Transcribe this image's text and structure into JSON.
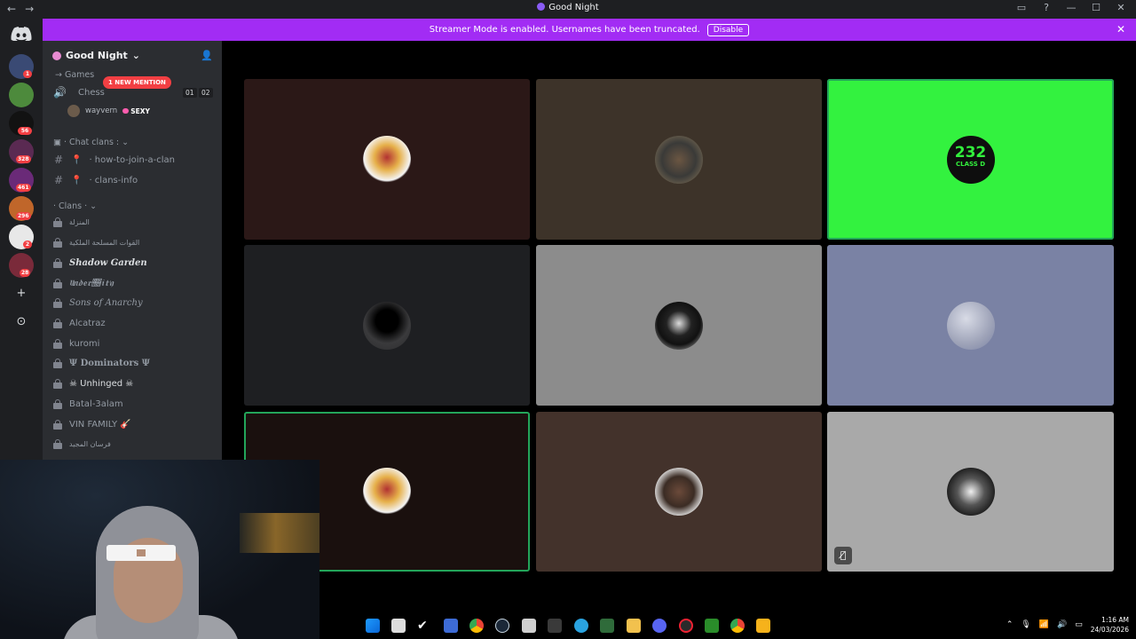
{
  "window": {
    "title": "Good Night",
    "nav_back": "←",
    "nav_forward": "→",
    "controls": [
      "▭",
      "?",
      "—",
      "☐",
      "✕"
    ]
  },
  "banner": {
    "text": "Streamer Mode is enabled. Usernames have been truncated.",
    "disable_label": "Disable",
    "close": "✕"
  },
  "guild_badges": [
    "1",
    "56",
    "328",
    "461",
    "296",
    "2",
    "28"
  ],
  "sidebar": {
    "server_name": "Good Night",
    "chevron": "⌄",
    "category_games": "→ Games",
    "mention_pill": "1 NEW MENTION",
    "voice_channel": "Chess",
    "voice_count_a": "01",
    "voice_count_b": "02",
    "voice_user": "wayvern",
    "voice_user_tag": "SEXY",
    "category_chat": "· Chat clans : ⌄",
    "channels_text": [
      "· how-to-join-a-clan",
      "· clans-info"
    ],
    "category_clans": "· Clans · ⌄",
    "clans": [
      "المنزلة",
      "القوات المسلحة الملكية",
      "Shadow Garden",
      "𝔘𝔫𝔡𝔢𝔯𝔆𝔦𝔱𝔶",
      "Sons of Anarchy",
      "Alcatraz",
      "kuromi",
      "Ψ Dominators Ψ",
      "☠ Unhinged ☠",
      "Batal-3alam",
      "VIN FAMILY 🎸",
      "فرسان المجيد"
    ]
  },
  "tiles": {
    "badge_number": "232",
    "badge_text": "CLASS D",
    "mute_icon": "🎙̸"
  },
  "taskbar": {
    "time": "1:16 AM",
    "date": "24/03/2026"
  },
  "colors": {
    "banner": "#a22cf4",
    "mention": "#f23f43",
    "speaking": "#23a55a",
    "bright_tile": "#33f23f"
  }
}
